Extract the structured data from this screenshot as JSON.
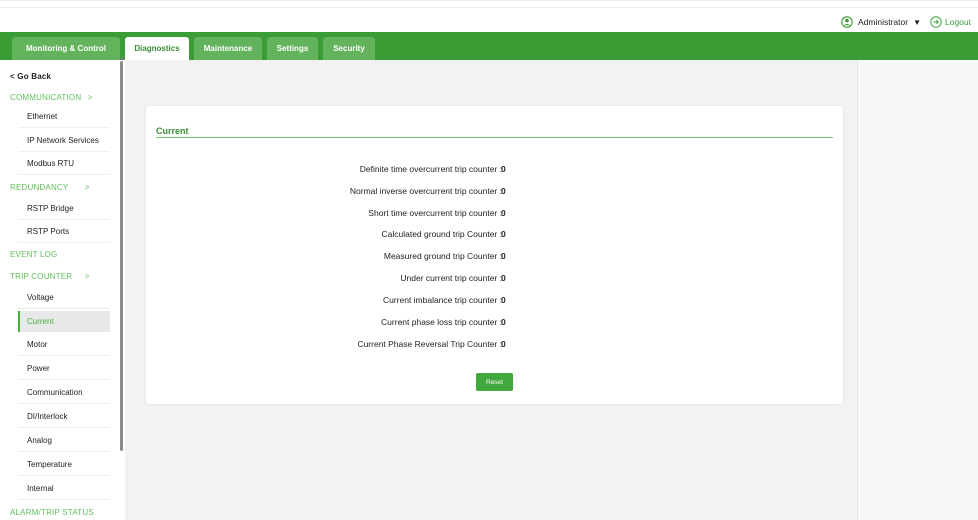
{
  "header": {
    "user_label": "Administrator",
    "user_caret": "▼",
    "logout_label": "Logout"
  },
  "nav": {
    "tabs": [
      {
        "label": "Monitoring & Control"
      },
      {
        "label": "Diagnostics"
      },
      {
        "label": "Maintenance"
      },
      {
        "label": "Settings"
      },
      {
        "label": "Security"
      }
    ],
    "active_tab": "Diagnostics"
  },
  "sidebar": {
    "back_label": "< Go Back",
    "sections": [
      {
        "label": "COMMUNICATION",
        "chevron": ">"
      },
      {
        "label": "REDUNDANCY",
        "chevron": ">"
      },
      {
        "label": "EVENT LOG"
      },
      {
        "label": "TRIP COUNTER",
        "chevron": ">"
      },
      {
        "label": "ALARM/TRIP STATUS"
      }
    ],
    "items": [
      {
        "label": "Ethernet"
      },
      {
        "label": "IP Network Services"
      },
      {
        "label": "Modbus RTU"
      },
      {
        "label": "RSTP Bridge"
      },
      {
        "label": "RSTP Ports"
      },
      {
        "label": "Voltage"
      },
      {
        "label": "Current"
      },
      {
        "label": "Motor"
      },
      {
        "label": "Power"
      },
      {
        "label": "Communication"
      },
      {
        "label": "DI/Interlock"
      },
      {
        "label": "Analog"
      },
      {
        "label": "Temperature"
      },
      {
        "label": "Internal"
      }
    ],
    "selected_item": "Current"
  },
  "card": {
    "title": "Current",
    "rows": [
      {
        "label": "Definite time overcurrent trip counter :",
        "value": "0"
      },
      {
        "label": "Normal inverse overcurrent trip counter :",
        "value": "0"
      },
      {
        "label": "Short time overcurrent trip counter :",
        "value": "0"
      },
      {
        "label": "Calculated ground trip Counter :",
        "value": "0"
      },
      {
        "label": "Measured ground trip Counter :",
        "value": "0"
      },
      {
        "label": "Under current trip counter :",
        "value": "0"
      },
      {
        "label": "Current imbalance trip counter :",
        "value": "0"
      },
      {
        "label": "Current phase loss trip counter :",
        "value": "0"
      },
      {
        "label": "Current Phase Reversal Trip Counter :",
        "value": "0"
      }
    ],
    "reset_label": "Reset"
  },
  "colors": {
    "brand_green": "#3a9c35",
    "tab_green": "#63b35c",
    "accent_green": "#46b040"
  }
}
